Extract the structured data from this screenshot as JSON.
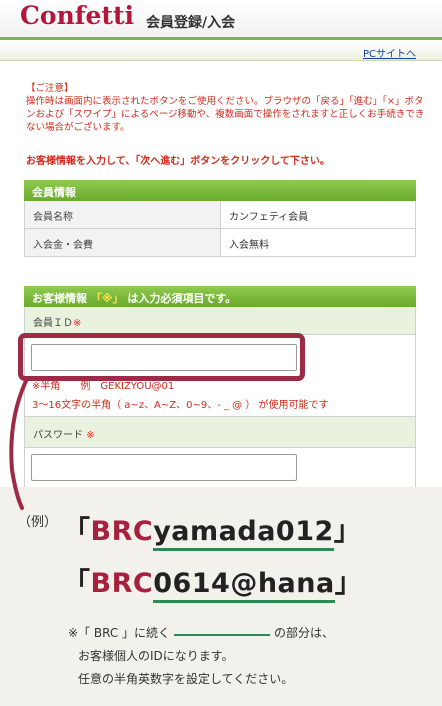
{
  "header": {
    "logo": "Confetti",
    "title": "会員登録/入会"
  },
  "pc_link": "PCサイトへ",
  "notice": {
    "title": "【ご注意】",
    "body": "操作時は画面内に表示されたボタンをご使用ください。ブラウザの「戻る」「進む」「×」ボタンおよび「スワイプ」によるページ移動や、複数画面で操作をされますと正しくお手続きできない場合がございます。"
  },
  "instruction": "お客様情報を入力して、「次へ進む」ボタンをクリックして下さい。",
  "member_info": {
    "header": "会員情報",
    "rows": [
      {
        "label": "会員名称",
        "value": "カンフェティ会員"
      },
      {
        "label": "入会金・会費",
        "value": "入会無料"
      }
    ]
  },
  "customer_info": {
    "header_prefix": "お客様情報",
    "header_mark": "「※」",
    "header_suffix": "は入力必須項目です。",
    "member_id_label": "会員ＩＤ",
    "required_mark": "※",
    "member_id_value": "",
    "hint_example": "※半角　　例　GEKIZYOU@01",
    "hint_rule": "3～16文字の半角（ a~z、A~Z、0~9、- _ @ ） が使用可能です",
    "password_label": "パスワード",
    "password_value": ""
  },
  "example": {
    "label": "（例）",
    "line1": {
      "open": "「",
      "prefix": "BRC",
      "rest": "yamada012",
      "close": "」"
    },
    "line2": {
      "open": "「",
      "prefix": "BRC",
      "rest": "0614@hana",
      "close": "」"
    },
    "note_line1_a": "※「 BRC 」に続く",
    "note_line1_b": "の部分は、",
    "note_line2": "お客様個人のIDになります。",
    "note_line3": "任意の半角英数字を設定してください。"
  },
  "colors": {
    "brand": "#b3153b",
    "accent_green": "#7fb541",
    "highlight": "#9d2b46",
    "alert_red": "#d12b1c"
  }
}
